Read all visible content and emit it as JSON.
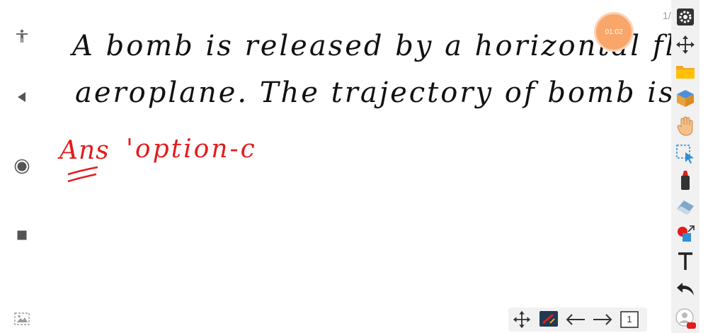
{
  "navigation": {
    "accessibility_icon": "accessibility-icon",
    "back_icon": "back-triangle-icon",
    "home_icon": "home-circle-icon",
    "recents_icon": "recents-square-icon",
    "gallery_icon": "gallery-icon"
  },
  "canvas": {
    "question_line_1": "A bomb is released by a horizontal flying",
    "question_line_2": "aeroplane. The trajectory of bomb is",
    "answer_label": "Ans",
    "answer_value": "'option-c",
    "ink_color": "#111111",
    "answer_color": "#e31c1c"
  },
  "timer": {
    "value": "01:02",
    "color": "#f9a66b"
  },
  "page_indicator": "1/",
  "tools": [
    "settings-gear-icon",
    "move-arrows-icon",
    "folder-icon",
    "box-icon",
    "hand-icon",
    "selection-icon",
    "marker-icon",
    "eraser-icon",
    "shapes-icon",
    "text-icon",
    "undo-icon",
    "avatar-icon"
  ],
  "bottom_toolbar": {
    "page_number": "1"
  }
}
